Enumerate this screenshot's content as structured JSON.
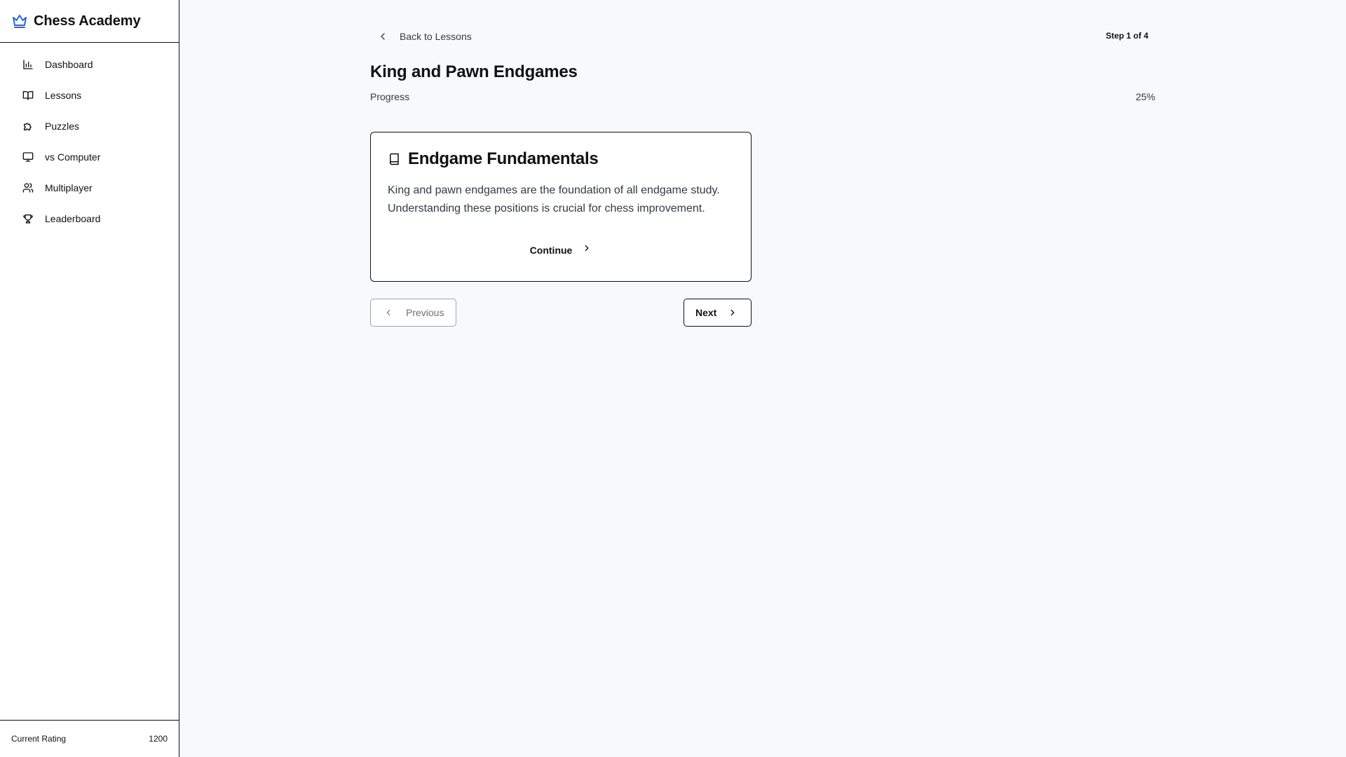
{
  "app": {
    "name": "Chess Academy",
    "brand_color": "#2563eb",
    "brand_icon": "crown-icon"
  },
  "sidebar": {
    "items": [
      {
        "label": "Dashboard",
        "icon": "bar-chart-icon"
      },
      {
        "label": "Lessons",
        "icon": "book-open-icon"
      },
      {
        "label": "Puzzles",
        "icon": "puzzle-icon"
      },
      {
        "label": "vs Computer",
        "icon": "monitor-icon"
      },
      {
        "label": "Multiplayer",
        "icon": "users-icon"
      },
      {
        "label": "Leaderboard",
        "icon": "trophy-icon"
      }
    ],
    "rating": {
      "label": "Current Rating",
      "value": "1200"
    }
  },
  "header": {
    "back_label": "Back to Lessons",
    "step_label": "Step 1 of 4"
  },
  "lesson": {
    "title": "King and Pawn Endgames",
    "progress_label": "Progress",
    "progress_value": "25%"
  },
  "card": {
    "title": "Endgame Fundamentals",
    "icon": "book-icon",
    "body": "King and pawn endgames are the foundation of all endgame study. Understanding these positions is crucial for chess improvement.",
    "continue_label": "Continue"
  },
  "nav_buttons": {
    "previous_label": "Previous",
    "next_label": "Next"
  }
}
